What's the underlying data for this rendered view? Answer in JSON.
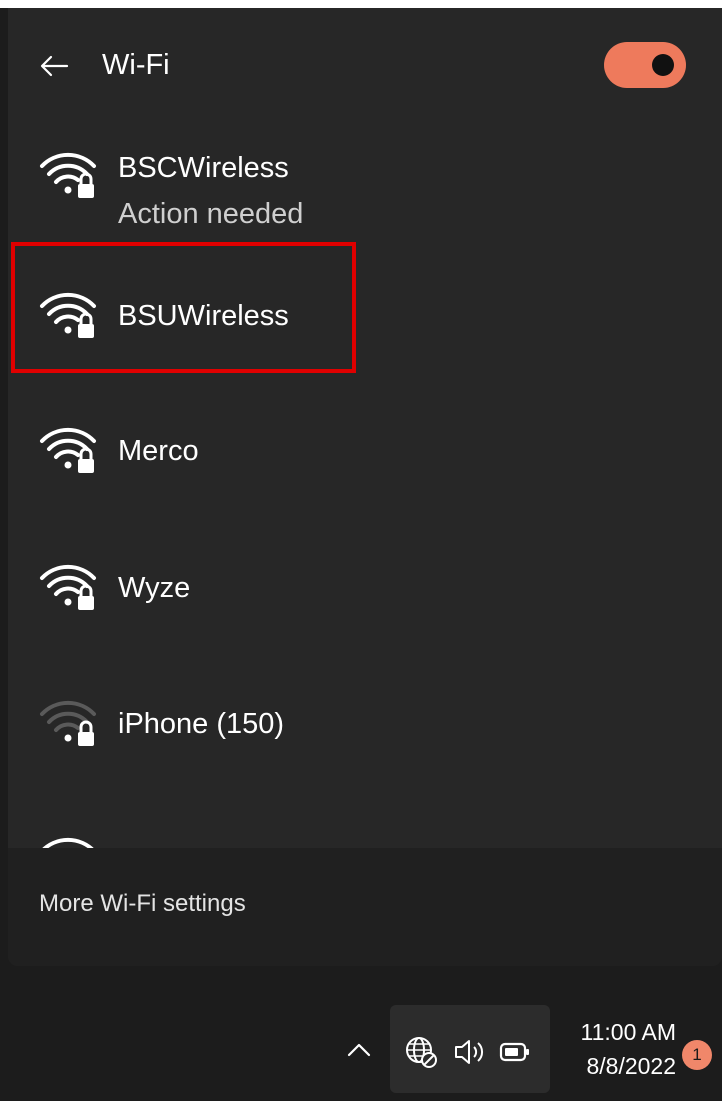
{
  "header": {
    "title": "Wi-Fi",
    "back_icon": "arrow-left-icon",
    "toggle_on": true,
    "accent_color": "#ee7a5c"
  },
  "networks": [
    {
      "name": "BSCWireless",
      "status": "Action needed",
      "secured": true,
      "signal": "strong"
    },
    {
      "name": "BSUWireless",
      "status": "",
      "secured": true,
      "signal": "strong",
      "highlighted": true
    },
    {
      "name": "Merco",
      "status": "",
      "secured": true,
      "signal": "strong"
    },
    {
      "name": "Wyze",
      "status": "",
      "secured": true,
      "signal": "strong"
    },
    {
      "name": "iPhone (150)",
      "status": "",
      "secured": true,
      "signal": "weak"
    }
  ],
  "footer": {
    "more_settings_label": "More Wi-Fi settings"
  },
  "taskbar": {
    "chevron_icon": "chevron-up-icon",
    "tray_icons": [
      "globe-no-internet-icon",
      "speaker-icon",
      "battery-icon"
    ],
    "time": "11:00 AM",
    "date": "8/8/2022",
    "notification_count": "1",
    "badge_color": "#f0876a"
  },
  "colors": {
    "panel_bg": "#272727",
    "highlight_border": "#e00000"
  }
}
